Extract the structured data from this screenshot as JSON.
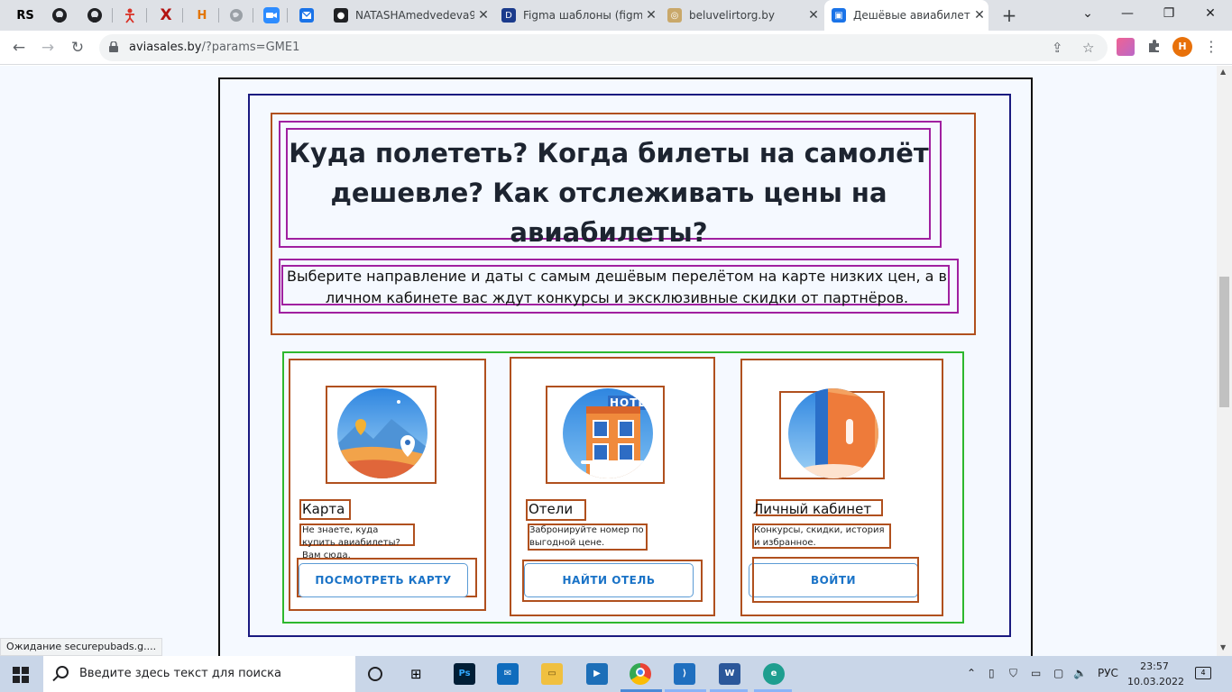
{
  "browser": {
    "pinned_tabs": [
      "RS",
      "",
      "",
      "",
      "X",
      "H",
      "",
      "",
      ""
    ],
    "tabs": [
      {
        "label": "NATASHAmedvedeva9",
        "close": "✕"
      },
      {
        "label": "Figma шаблоны (figm",
        "close": "✕"
      },
      {
        "label": "beluvelirtorg.by",
        "close": "✕"
      },
      {
        "label": "Дешёвые авиабилет",
        "close": "✕"
      }
    ],
    "new_tab": "+",
    "url_host": "aviasales.by",
    "url_path": "/?params=GME1",
    "profile_initial": "H"
  },
  "page": {
    "hero": {
      "title": "Куда полететь? Когда билеты на самолёт дешевле? Как отслеживать цены на авиабилеты?",
      "subtitle": "Выберите направление и даты с самым дешёвым перелётом на карте низких цен, а в личном кабинете вас ждут конкурсы и эксклюзивные скидки от партнёров."
    },
    "cards": [
      {
        "title": "Карта",
        "desc": "Не знаете, куда купить авиабилеты? Вам сюда.",
        "button": "ПОСМОТРЕТЬ КАРТУ",
        "icon": "map-pin-icon"
      },
      {
        "title": "Отели",
        "desc": "Забронируйте номер по выгодной цене.",
        "button": "НАЙТИ ОТЕЛЬ",
        "icon": "hotel-icon",
        "icon_sign": "HOTE"
      },
      {
        "title": "Личный кабинет",
        "desc": "Конкурсы, скидки, история и избранное.",
        "button": "ВОЙТИ",
        "icon": "door-icon"
      }
    ]
  },
  "status_text": "Ожидание securepubads.g....",
  "taskbar": {
    "search_placeholder": "Введите здесь текст для поиска",
    "language": "РУС",
    "time": "23:57",
    "date": "10.03.2022",
    "notifications": "4"
  }
}
